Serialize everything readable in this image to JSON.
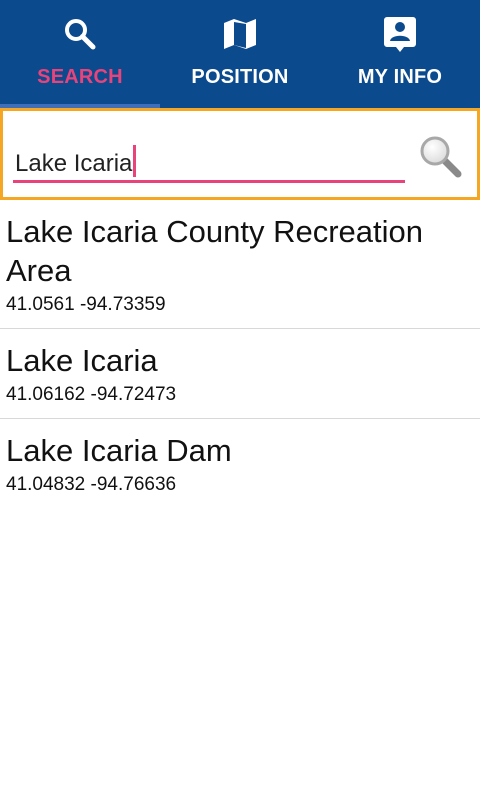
{
  "tabs": [
    {
      "label": "SEARCH",
      "icon": "search-icon",
      "active": true
    },
    {
      "label": "POSITION",
      "icon": "map-icon",
      "active": false
    },
    {
      "label": "MY INFO",
      "icon": "contact-card-icon",
      "active": false
    }
  ],
  "search": {
    "value": "Lake Icaria",
    "button_icon": "magnifier-icon"
  },
  "results": [
    {
      "name": "Lake Icaria County Recreation Area",
      "coords": "41.0561 -94.73359"
    },
    {
      "name": "Lake Icaria",
      "coords": "41.06162 -94.72473"
    },
    {
      "name": "Lake Icaria Dam",
      "coords": "41.04832 -94.76636"
    }
  ],
  "colors": {
    "header_bg": "#0c4a8e",
    "active_tab": "#e8437a",
    "focus_border": "#f5a623",
    "underline": "#e8437a"
  }
}
